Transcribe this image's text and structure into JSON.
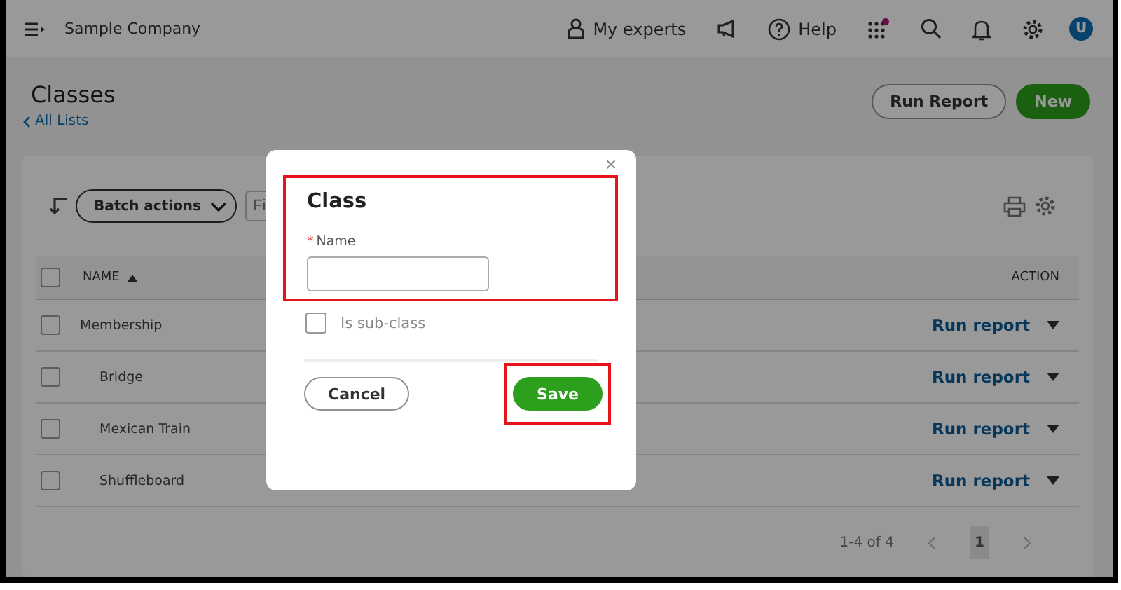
{
  "top_bar": {
    "company": "Sample Company",
    "my_experts": "My experts",
    "help": "Help",
    "apps_notification": true,
    "avatar": "U"
  },
  "header": {
    "title": "Classes",
    "back_link": "All Lists",
    "buttons": [
      {
        "label": "Run Report",
        "kind": "secondary"
      },
      {
        "label": "New",
        "kind": "primary"
      }
    ]
  },
  "toolbar": {
    "batch_actions": "Batch actions",
    "filter_placeholder": "Fi"
  },
  "table": {
    "select_all_checked": false,
    "columns": [
      {
        "label": "NAME",
        "sort_ascending": true
      },
      {
        "label": "ACTION"
      }
    ],
    "rows": [
      {
        "name": "Membership",
        "checked": false,
        "action": "Run report",
        "children": [
          {
            "name": "Bridge",
            "checked": false,
            "action": "Run report"
          },
          {
            "name": "Mexican Train",
            "checked": false,
            "action": "Run report"
          },
          {
            "name": "Shuffleboard",
            "checked": false,
            "action": "Run report"
          }
        ]
      }
    ]
  },
  "pagination": {
    "range": "1-4 of 4",
    "pages": [
      {
        "label": "1",
        "selected": true
      }
    ]
  },
  "dialog": {
    "title": "Class",
    "close": "×",
    "form_highlighted": true,
    "fields": [
      {
        "label": "Name",
        "required_mark": "*"
      }
    ],
    "sub_class": {
      "label": "Is sub-class",
      "checked": false
    },
    "buttons": [
      {
        "label": "Cancel",
        "kind": "secondary",
        "highlighted": false
      },
      {
        "label": "Save",
        "kind": "primary",
        "highlighted": true
      }
    ]
  }
}
